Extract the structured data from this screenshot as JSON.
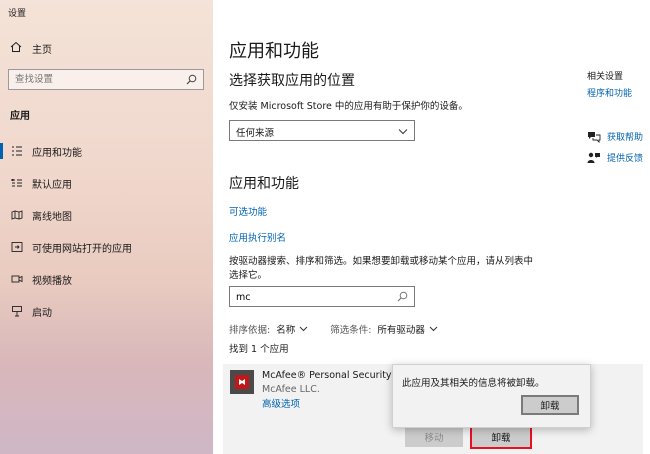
{
  "window_title": "设置",
  "sidebar": {
    "home_label": "主页",
    "search_placeholder": "查找设置",
    "section_title": "应用",
    "items": [
      {
        "label": "应用和功能",
        "icon": "list-icon",
        "active": true
      },
      {
        "label": "默认应用",
        "icon": "default-apps-icon",
        "active": false
      },
      {
        "label": "离线地图",
        "icon": "map-icon",
        "active": false
      },
      {
        "label": "可使用网站打开的应用",
        "icon": "web-apps-icon",
        "active": false
      },
      {
        "label": "视频播放",
        "icon": "video-icon",
        "active": false
      },
      {
        "label": "启动",
        "icon": "startup-icon",
        "active": false
      }
    ]
  },
  "main": {
    "title": "应用和功能",
    "install_section": {
      "heading": "选择获取应用的位置",
      "description": "仅安装 Microsoft Store 中的应用有助于保护你的设备。",
      "dropdown_value": "任何来源"
    },
    "apps_section": {
      "heading": "应用和功能",
      "optional_features_link": "可选功能",
      "aliases_link": "应用执行别名",
      "description": "按驱动器搜索、排序和筛选。如果想要卸载或移动某个应用，请从列表中选择它。",
      "search_value": "mc",
      "sort_label": "排序依据:",
      "sort_value": "名称",
      "filter_label": "筛选条件:",
      "filter_value": "所有驱动器",
      "result_count": "找到 1 个应用"
    },
    "app_item": {
      "name": "McAfee® Personal Security",
      "publisher": "McAfee LLC.",
      "advanced_link": "高级选项",
      "move_button": "移动",
      "uninstall_button": "卸载"
    },
    "popup": {
      "message": "此应用及其相关的信息将被卸载。",
      "button": "卸载"
    }
  },
  "related": {
    "title": "相关设置",
    "link": "程序和功能",
    "help_link": "获取帮助",
    "feedback_link": "提供反馈"
  },
  "colors": {
    "accent": "#0063b1",
    "highlight_border": "#e81123",
    "mcafee_red": "#c01818"
  }
}
